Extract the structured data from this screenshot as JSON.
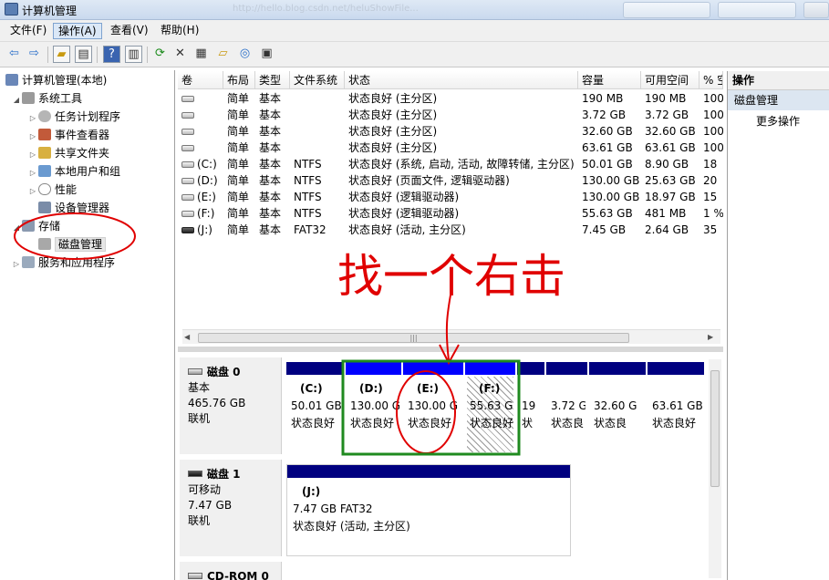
{
  "window": {
    "title": "计算机管理",
    "watermark": "http://hello.blog.csdn.net/heluShowFile..."
  },
  "menu": [
    "文件(F)",
    "操作(A)",
    "查看(V)",
    "帮助(H)"
  ],
  "toolbar": {
    "icons": [
      "back-arrow-icon",
      "forward-arrow-icon",
      "up-folder-icon",
      "show-hide-tree-icon",
      "help-icon",
      "action-pane-icon",
      "refresh-icon",
      "delete-icon",
      "properties-icon",
      "open-folder-icon",
      "search-icon",
      "disk-settings-icon"
    ]
  },
  "tree": {
    "root": "计算机管理(本地)",
    "system_tools": "系统工具",
    "task_scheduler": "任务计划程序",
    "event_viewer": "事件查看器",
    "shared_folders": "共享文件夹",
    "local_users": "本地用户和组",
    "performance": "性能",
    "device_manager": "设备管理器",
    "storage": "存储",
    "disk_management": "磁盘管理",
    "services_apps": "服务和应用程序"
  },
  "volumes": {
    "columns": [
      "卷",
      "布局",
      "类型",
      "文件系统",
      "状态",
      "容量",
      "可用空间",
      "% 空"
    ],
    "rows": [
      {
        "vol": "",
        "layout": "简单",
        "type": "基本",
        "fs": "",
        "status": "状态良好 (主分区)",
        "cap": "190 MB",
        "free": "190 MB",
        "pct": "100"
      },
      {
        "vol": "",
        "layout": "简单",
        "type": "基本",
        "fs": "",
        "status": "状态良好 (主分区)",
        "cap": "3.72 GB",
        "free": "3.72 GB",
        "pct": "100"
      },
      {
        "vol": "",
        "layout": "简单",
        "type": "基本",
        "fs": "",
        "status": "状态良好 (主分区)",
        "cap": "32.60 GB",
        "free": "32.60 GB",
        "pct": "100"
      },
      {
        "vol": "",
        "layout": "简单",
        "type": "基本",
        "fs": "",
        "status": "状态良好 (主分区)",
        "cap": "63.61 GB",
        "free": "63.61 GB",
        "pct": "100"
      },
      {
        "vol": "(C:)",
        "layout": "简单",
        "type": "基本",
        "fs": "NTFS",
        "status": "状态良好 (系统, 启动, 活动, 故障转储, 主分区)",
        "cap": "50.01 GB",
        "free": "8.90 GB",
        "pct": "18"
      },
      {
        "vol": "(D:)",
        "layout": "简单",
        "type": "基本",
        "fs": "NTFS",
        "status": "状态良好 (页面文件, 逻辑驱动器)",
        "cap": "130.00 GB",
        "free": "25.63 GB",
        "pct": "20"
      },
      {
        "vol": "(E:)",
        "layout": "简单",
        "type": "基本",
        "fs": "NTFS",
        "status": "状态良好 (逻辑驱动器)",
        "cap": "130.00 GB",
        "free": "18.97 GB",
        "pct": "15"
      },
      {
        "vol": "(F:)",
        "layout": "简单",
        "type": "基本",
        "fs": "NTFS",
        "status": "状态良好 (逻辑驱动器)",
        "cap": "55.63 GB",
        "free": "481 MB",
        "pct": "1 %"
      },
      {
        "vol": "(J:)",
        "layout": "简单",
        "type": "基本",
        "fs": "FAT32",
        "status": "状态良好 (活动, 主分区)",
        "cap": "7.45 GB",
        "free": "2.64 GB",
        "pct": "35"
      }
    ]
  },
  "disk0": {
    "name": "磁盘 0",
    "type": "基本",
    "size": "465.76 GB",
    "state": "联机",
    "partitions": [
      {
        "name": "(C:)",
        "size": "50.01 GB",
        "status": "状态良好"
      },
      {
        "name": "(D:)",
        "size": "130.00 G",
        "status": "状态良好"
      },
      {
        "name": "(E:)",
        "size": "130.00 G",
        "status": "状态良好"
      },
      {
        "name": "(F:)",
        "size": "55.63 G",
        "status": "状态良好"
      },
      {
        "name": "",
        "size": "19",
        "status": "状"
      },
      {
        "name": "",
        "size": "3.72 G",
        "status": "状态良"
      },
      {
        "name": "",
        "size": "32.60 G",
        "status": "状态良"
      },
      {
        "name": "",
        "size": "63.61 GB",
        "status": "状态良好"
      }
    ]
  },
  "disk1": {
    "name": "磁盘 1",
    "type": "可移动",
    "size": "7.47 GB",
    "state": "联机",
    "partition": {
      "name": "(J:)",
      "size": "7.47 GB FAT32",
      "status": "状态良好 (活动, 主分区)"
    }
  },
  "cdrom": {
    "name": "CD-ROM 0"
  },
  "actions": {
    "header": "操作",
    "section": "磁盘管理",
    "more": "更多操作"
  },
  "annotation": {
    "text": "找一个右击",
    "color": "#e00000"
  }
}
